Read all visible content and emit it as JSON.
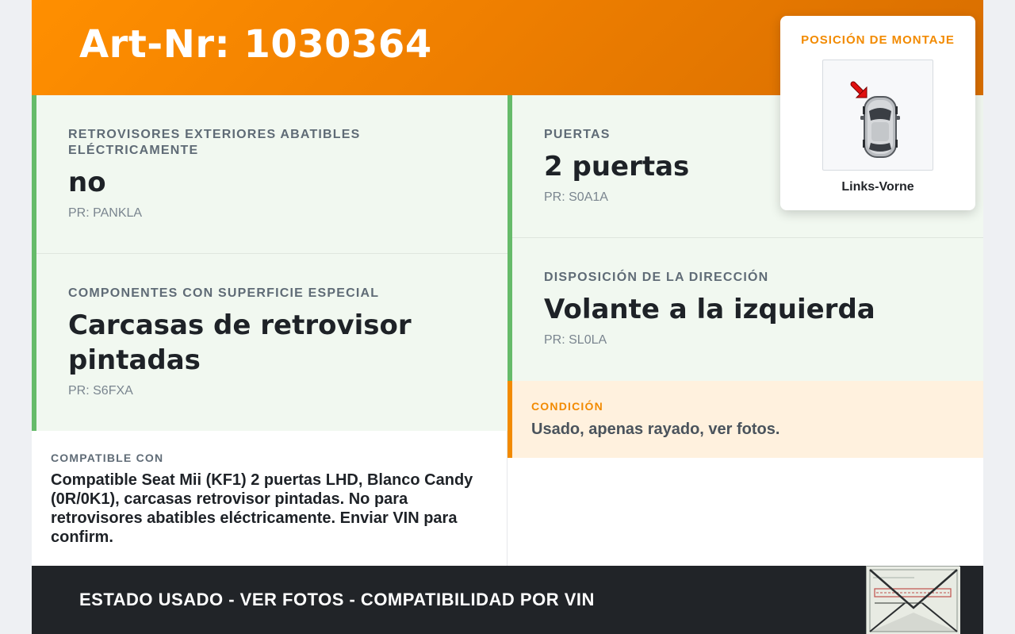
{
  "header": {
    "title": "Art-Nr: 1030364"
  },
  "mount_position": {
    "title": "POSICIÓN DE MONTAJE",
    "caption": "Links-Vorne",
    "arrow_color": "#e01010"
  },
  "specs": [
    {
      "label": "RETROVISORES EXTERIORES ABATIBLES ELÉCTRICAMENTE",
      "value": "no",
      "pr": "PR: PANKLA"
    },
    {
      "label": "PUERTAS",
      "value": "2 puertas",
      "pr": "PR: S0A1A"
    },
    {
      "label": "COMPONENTES CON SUPERFICIE ESPECIAL",
      "value": "Carcasas de retrovisor pintadas",
      "pr": "PR: S6FXA"
    },
    {
      "label": "DISPOSICIÓN DE LA DIRECCIÓN",
      "value": "Volante a la izquierda",
      "pr": "PR: SL0LA"
    }
  ],
  "condition": {
    "label": "CONDICIÓN",
    "text": "Usado, apenas rayado, ver fotos."
  },
  "compatible": {
    "label": "COMPATIBLE CON",
    "text": "Compatible Seat Mii (KF1) 2 puertas LHD, Blanco Candy (0R/0K1), carcasas retrovisor pintadas. No para retrovisores abatibles eléctricamente. Enviar VIN para confirm."
  },
  "footer": {
    "text": "ESTADO USADO - VER FOTOS - COMPATIBILIDAD POR VIN"
  },
  "colors": {
    "accent_orange": "#f28a00",
    "spec_green": "#66bb6a",
    "footer_dark": "#212428"
  }
}
